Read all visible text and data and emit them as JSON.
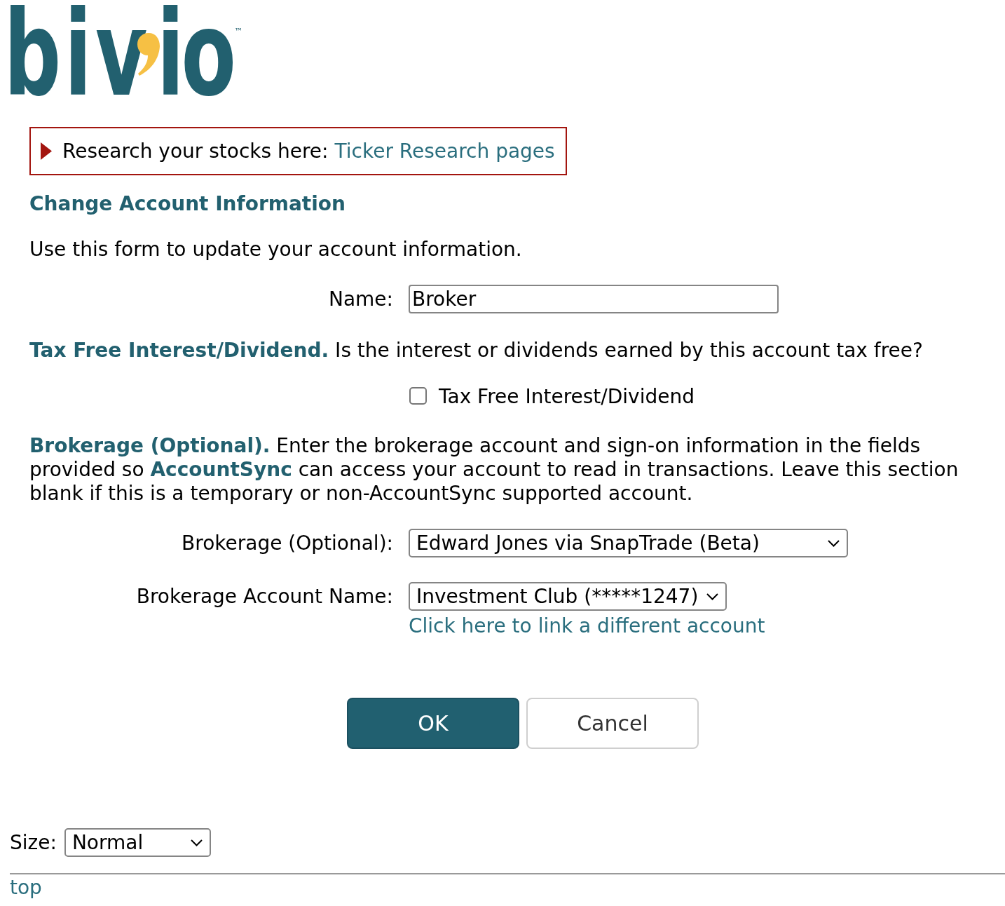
{
  "logo": {
    "wordmark": "bivio",
    "trademark": "™"
  },
  "notice": {
    "text": "Research your stocks here:",
    "link": "Ticker Research pages"
  },
  "heading": "Change Account Information",
  "intro": "Use this form to update your account information.",
  "name_field": {
    "label": "Name:",
    "value": "Broker"
  },
  "tax_free": {
    "description": "**Tax Free Interest/Dividend.** Is the interest or dividends earned by this account tax free?",
    "checkbox": {
      "label": "Tax Free Interest/Dividend",
      "checked": false
    }
  },
  "brokerage": {
    "description": "**Brokerage (Optional).** Enter the brokerage account and sign-on information in the fields provided so **AccountSync** can access your account to read in transactions. Leave this section blank if this is a temporary or non-AccountSync supported account.",
    "provider": {
      "label": "Brokerage (Optional):",
      "value": "Edward Jones via SnapTrade (Beta)"
    },
    "account": {
      "label": "Brokerage Account Name:",
      "value": "Investment Club (*****1247)",
      "link": "Click here to link a different account"
    }
  },
  "buttons": [
    {
      "label": "OK",
      "kind": "primary"
    },
    {
      "label": "Cancel",
      "kind": "secondary"
    }
  ],
  "footer": {
    "size": {
      "label": "Size:",
      "value": "Normal"
    },
    "top_link": "top"
  }
}
